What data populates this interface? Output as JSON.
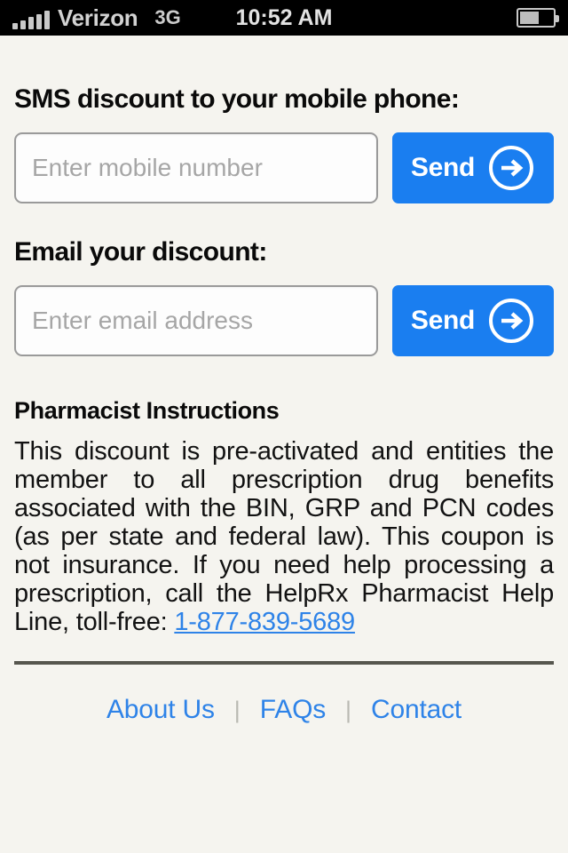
{
  "statusbar": {
    "carrier": "Verizon",
    "network": "3G",
    "time": "10:52 AM",
    "signal_bars": 5,
    "battery_percent": 52,
    "icons": {
      "signal": "signal-bars-icon",
      "battery": "battery-icon"
    }
  },
  "sms": {
    "title": "SMS discount to your mobile phone:",
    "input_placeholder": "Enter mobile number",
    "input_value": "",
    "send_label": "Send",
    "send_icon": "arrow-right-circle-icon"
  },
  "email": {
    "title": "Email your discount:",
    "input_placeholder": "Enter email address",
    "input_value": "",
    "send_label": "Send",
    "send_icon": "arrow-right-circle-icon"
  },
  "instructions": {
    "title": "Pharmacist Instructions",
    "body_before_phone": "This discount is pre-activated and entities the member to all prescription drug benefits associated with the BIN, GRP and PCN codes (as per state and federal law). This coupon is not insurance. If you need help processing a prescription, call the HelpRx Pharmacist Help Line, toll-free: ",
    "phone": "1-877-839-5689"
  },
  "footer": {
    "links": [
      {
        "label": "About Us"
      },
      {
        "label": "FAQs"
      },
      {
        "label": "Contact"
      }
    ],
    "separator": "|"
  },
  "colors": {
    "background": "#f5f4ef",
    "accent_blue": "#1a7ef0",
    "link_blue": "#2e83e8",
    "text": "#0a0a0a",
    "divider": "#56564e",
    "statusbar_bg": "#000000"
  }
}
